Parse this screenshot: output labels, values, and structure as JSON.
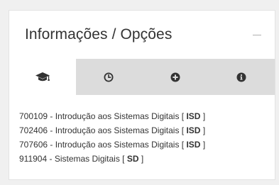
{
  "panel": {
    "title": "Informações / Opções"
  },
  "tabs": [
    {
      "icon": "graduation-cap-icon",
      "active": true
    },
    {
      "icon": "clock-icon",
      "active": false
    },
    {
      "icon": "plus-circle-icon",
      "active": false
    },
    {
      "icon": "info-circle-icon",
      "active": false
    }
  ],
  "courses": [
    {
      "prefix": "700109 - Introdução aos Sistemas Digitais [ ",
      "code": "ISD",
      "suffix": " ]"
    },
    {
      "prefix": "702406 - Introdução aos Sistemas Digitais [ ",
      "code": "ISD",
      "suffix": " ]"
    },
    {
      "prefix": "707606 - Introdução aos Sistemas Digitais [ ",
      "code": "ISD",
      "suffix": " ]"
    },
    {
      "prefix": "911904 - Sistemas Digitais [ ",
      "code": "SD",
      "suffix": " ]"
    }
  ],
  "colors": {
    "icon": "#333333",
    "tab_bar": "#dcdcdc"
  }
}
